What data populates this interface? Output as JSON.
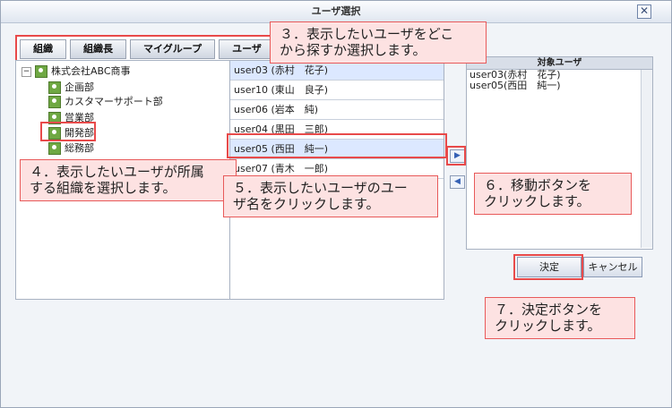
{
  "window": {
    "title": "ユーザ選択"
  },
  "tabs": [
    {
      "label": "組織"
    },
    {
      "label": "組織長"
    },
    {
      "label": "マイグループ"
    },
    {
      "label": "ユーザ"
    }
  ],
  "tree": {
    "root": {
      "toggle": "−",
      "label": "株式会社ABC商事"
    },
    "children": [
      {
        "label": "企画部"
      },
      {
        "label": "カスタマーサポート部"
      },
      {
        "label": "営業部"
      },
      {
        "label": "開発部"
      },
      {
        "label": "総務部"
      }
    ]
  },
  "users": [
    {
      "label": "user03 (赤村　花子)"
    },
    {
      "label": "user10 (東山　良子)"
    },
    {
      "label": "user06 (岩本　純)"
    },
    {
      "label": "user04 (黒田　三郎)"
    },
    {
      "label": "user05 (西田　純一)"
    },
    {
      "label": "user07 (青木　一郎)"
    }
  ],
  "target": {
    "header": "対象ユーザ",
    "items": [
      {
        "label": "user03(赤村　花子)"
      },
      {
        "label": "user05(西田　純一)"
      }
    ]
  },
  "buttons": {
    "ok": "決定",
    "cancel": "キャンセル",
    "move_right": "▶",
    "move_left": "◀",
    "close": "✕"
  },
  "callouts": {
    "step3": "３．表示したいユーザをどこ\nから探すか選択します。",
    "step4": "４．表示したいユーザが所属\nする組織を選択します。",
    "step5": "５．表示したいユーザのユー\nザ名をクリックします。",
    "step6": "６．移動ボタンを\nクリックします。",
    "step7": "７．決定ボタンを\nクリックします。"
  },
  "colors": {
    "accent_red": "#e84a4a",
    "selected": "#dce8ff"
  }
}
